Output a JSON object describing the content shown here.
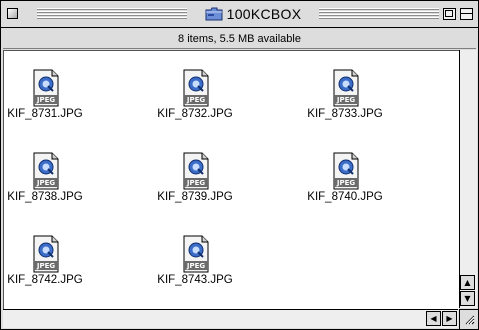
{
  "window": {
    "title": "100KCBOX",
    "folder_icon": "folder-icon"
  },
  "info_bar": {
    "text": "8 items, 5.5 MB available"
  },
  "files": [
    {
      "name": "KIF_8731.JPG",
      "icon": "jpeg-file-icon",
      "badge": "JPEG"
    },
    {
      "name": "KIF_8732.JPG",
      "icon": "jpeg-file-icon",
      "badge": "JPEG"
    },
    {
      "name": "KIF_8733.JPG",
      "icon": "jpeg-file-icon",
      "badge": "JPEG"
    },
    {
      "name": "KIF_8738.JPG",
      "icon": "jpeg-file-icon",
      "badge": "JPEG"
    },
    {
      "name": "KIF_8739.JPG",
      "icon": "jpeg-file-icon",
      "badge": "JPEG"
    },
    {
      "name": "KIF_8740.JPG",
      "icon": "jpeg-file-icon",
      "badge": "JPEG"
    },
    {
      "name": "KIF_8742.JPG",
      "icon": "jpeg-file-icon",
      "badge": "JPEG"
    },
    {
      "name": "KIF_8743.JPG",
      "icon": "jpeg-file-icon",
      "badge": "JPEG"
    }
  ],
  "scrollbars": {
    "up_icon": "arrow-up-icon",
    "down_icon": "arrow-down-icon",
    "left_icon": "arrow-left-icon",
    "right_icon": "arrow-right-icon",
    "grow_icon": "resize-grip-icon"
  },
  "colors": {
    "window_chrome": "#dddddd",
    "content_background": "#ffffff",
    "icon_accent": "#3a6cc8"
  }
}
